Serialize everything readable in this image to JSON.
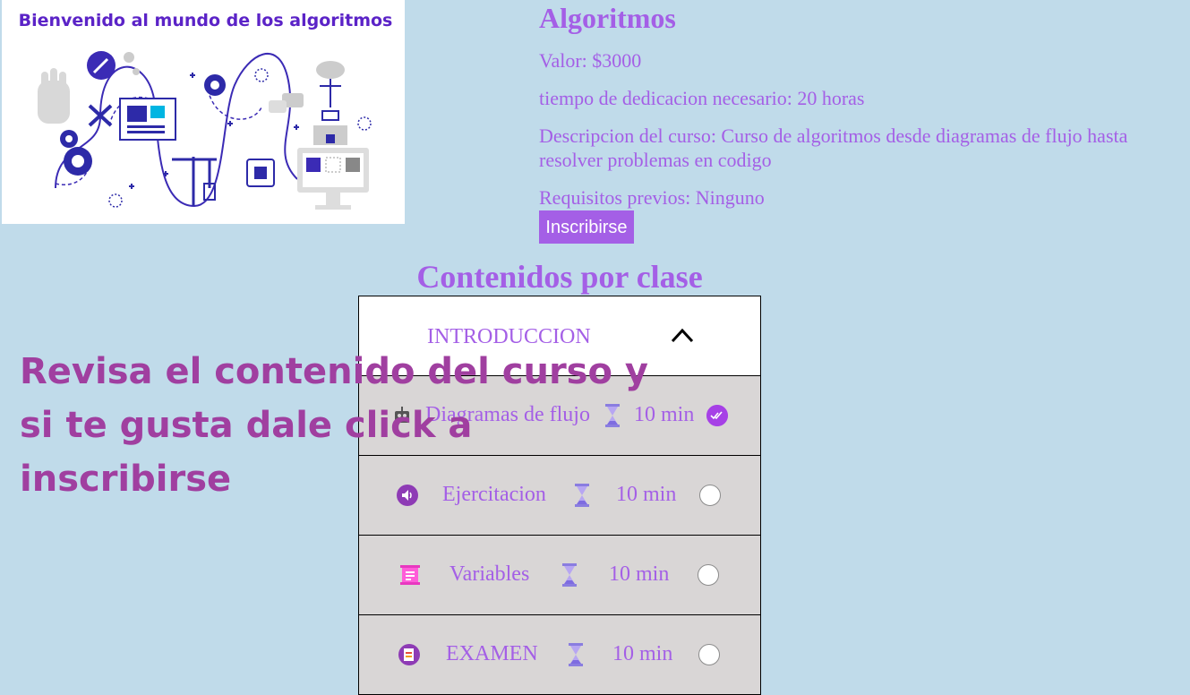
{
  "hero": {
    "caption": "Bienvenido al mundo de los algoritmos"
  },
  "course": {
    "title": "Algoritmos",
    "price": "Valor: $3000",
    "time": "tiempo de dedicacion necesario: 20 horas",
    "description": "Descripcion del curso: Curso de algoritmos desde diagramas de flujo hasta resolver problemas en codigo",
    "requirements": "Requisitos previos: Ninguno",
    "enroll_label": "Inscribirse"
  },
  "contents": {
    "heading": "Contenidos por clase",
    "section_title": "INTRODUCCION",
    "lessons": [
      {
        "title": "Diagramas de flujo",
        "duration": "10 min",
        "icon": "robot-icon",
        "completed": true
      },
      {
        "title": "Ejercitacion",
        "duration": "10 min",
        "icon": "speaker-icon",
        "completed": false
      },
      {
        "title": "Variables",
        "duration": "10 min",
        "icon": "document-icon",
        "completed": false
      },
      {
        "title": "EXAMEN",
        "duration": "10 min",
        "icon": "exam-icon",
        "completed": false
      }
    ]
  },
  "overlay": {
    "text": "Revisa el contenido del curso y si te gusta dale click a inscribirse"
  },
  "colors": {
    "background": "#c0dbea",
    "accent": "#a45fe6",
    "overlay_text": "#a03fa0",
    "row_background": "#d9d6d6",
    "completed": "#a640e6"
  }
}
